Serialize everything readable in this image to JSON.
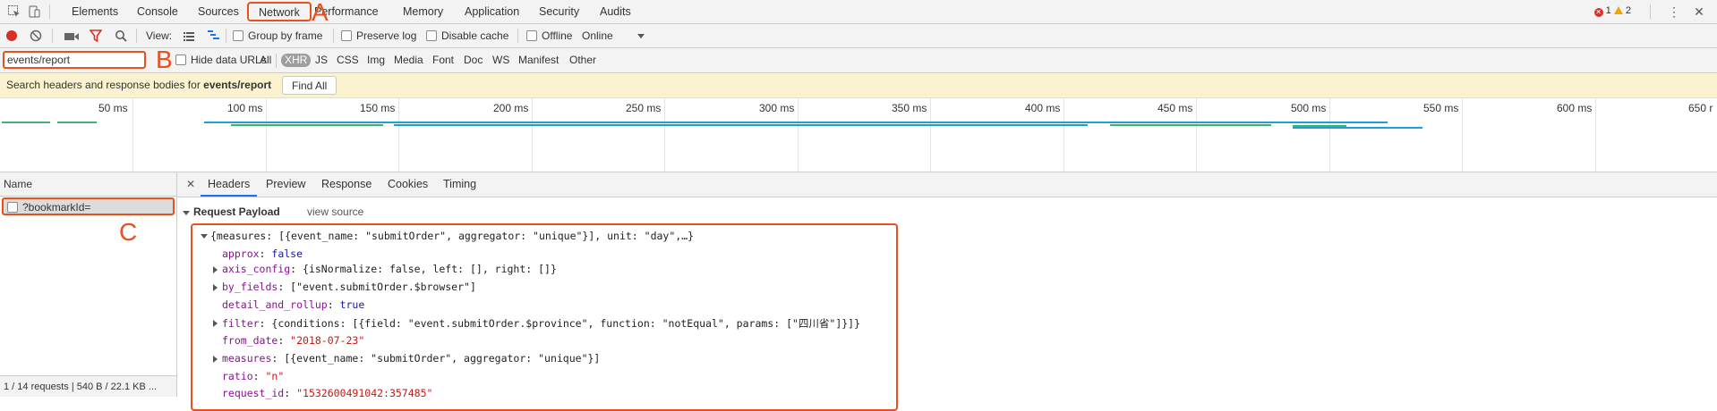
{
  "tabs": [
    "Elements",
    "Console",
    "Sources",
    "Network",
    "Performance",
    "Memory",
    "Application",
    "Security",
    "Audits"
  ],
  "status_counts": {
    "errors": "1",
    "warnings": "2"
  },
  "toolbar": {
    "view_label": "View:",
    "group_by_frame": "Group by frame",
    "preserve_log": "Preserve log",
    "disable_cache": "Disable cache",
    "offline": "Offline",
    "throttle": "Online"
  },
  "filter": {
    "value": "events/report",
    "hide_data_urls": "Hide data URLs",
    "types": [
      "All",
      "XHR",
      "JS",
      "CSS",
      "Img",
      "Media",
      "Font",
      "Doc",
      "WS",
      "Manifest",
      "Other"
    ]
  },
  "search_banner": {
    "prefix": "Search headers and response bodies for",
    "term": "events/report",
    "button": "Find All"
  },
  "timeline": {
    "ticks": [
      "50 ms",
      "100 ms",
      "150 ms",
      "200 ms",
      "250 ms",
      "300 ms",
      "350 ms",
      "400 ms",
      "450 ms",
      "500 ms",
      "550 ms",
      "600 ms",
      "650 r"
    ]
  },
  "requests": {
    "header": "Name",
    "items": [
      "?bookmarkId="
    ],
    "summary": "1 / 14 requests | 540 B / 22.1 KB ..."
  },
  "detail": {
    "tabs": [
      "Headers",
      "Preview",
      "Response",
      "Cookies",
      "Timing"
    ],
    "section": "Request Payload",
    "view_source": "view source",
    "lines": {
      "root": "{measures: [{event_name: \"submitOrder\", aggregator: \"unique\"}], unit: \"day\",…}",
      "approx_key": "approx",
      "approx_val": "false",
      "axis_key": "axis_config",
      "axis_val": "{isNormalize: false, left: [], right: []}",
      "by_key": "by_fields",
      "by_val": "[\"event.submitOrder.$browser\"]",
      "detail_key": "detail_and_rollup",
      "detail_val": "true",
      "filter_key": "filter",
      "filter_val": "{conditions: [{field: \"event.submitOrder.$province\", function: \"notEqual\", params: [\"四川省\"]}]}",
      "from_key": "from_date",
      "from_val": "\"2018-07-23\"",
      "measures_key": "measures",
      "measures_val": "[{event_name: \"submitOrder\", aggregator: \"unique\"}]",
      "ratio_key": "ratio",
      "ratio_val": "\"n\"",
      "request_key": "request_id",
      "request_val": "\"1532600491042:357485\""
    }
  },
  "annotations": {
    "a": "A",
    "b": "B",
    "c": "C"
  },
  "colors": {
    "accent": "#1a73e8",
    "highlight": "#e8501e",
    "banner": "#fbf3cf"
  }
}
